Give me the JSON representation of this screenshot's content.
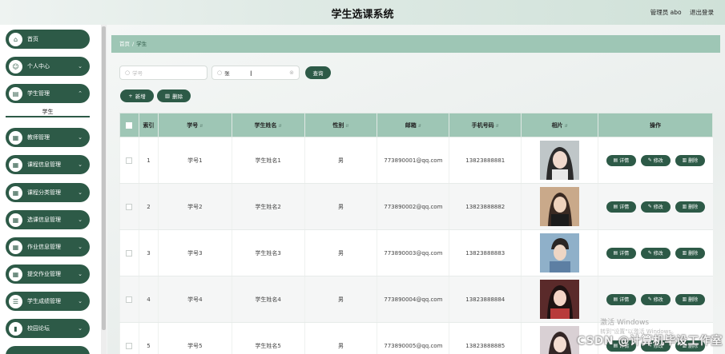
{
  "header": {
    "title": "学生选课系统",
    "user": "管理员 abo",
    "logout": "退出登录"
  },
  "sidebar": {
    "items": [
      {
        "label": "首页",
        "icon": "home-icon",
        "glyph": "⌂",
        "expandable": false
      },
      {
        "label": "个人中心",
        "icon": "user-icon",
        "glyph": "☺",
        "expandable": true
      },
      {
        "label": "学生管理",
        "icon": "document-icon",
        "glyph": "▤",
        "expandable": true
      },
      {
        "label": "教师管理",
        "icon": "grid-icon",
        "glyph": "▦",
        "expandable": true
      },
      {
        "label": "课程信息管理",
        "icon": "grid-icon",
        "glyph": "▦",
        "expandable": true
      },
      {
        "label": "课程分类管理",
        "icon": "grid-icon",
        "glyph": "▦",
        "expandable": true
      },
      {
        "label": "选课信息管理",
        "icon": "grid-icon",
        "glyph": "▦",
        "expandable": true
      },
      {
        "label": "作业信息管理",
        "icon": "grid-icon",
        "glyph": "▦",
        "expandable": true
      },
      {
        "label": "提交作业管理",
        "icon": "grid-icon",
        "glyph": "▦",
        "expandable": true
      },
      {
        "label": "学生成绩管理",
        "icon": "list-icon",
        "glyph": "☰",
        "expandable": true
      },
      {
        "label": "校园论坛",
        "icon": "chart-icon",
        "glyph": "▮",
        "expandable": true
      }
    ],
    "sub_item": "学生"
  },
  "breadcrumb": {
    "home": "首页",
    "sep": "/",
    "current": "学生"
  },
  "search": {
    "student_id_placeholder": "学号",
    "student_name_value": "张",
    "query_label": "查询"
  },
  "actions": {
    "add_label": "新增",
    "delete_label": "删除"
  },
  "table": {
    "columns": [
      "索引",
      "学号",
      "学生姓名",
      "性别",
      "邮箱",
      "手机号码",
      "相片",
      "操作"
    ],
    "rows": [
      {
        "index": "1",
        "id": "学号1",
        "name": "学生姓名1",
        "gender": "男",
        "email": "773890001@qq.com",
        "phone": "13823888881"
      },
      {
        "index": "2",
        "id": "学号2",
        "name": "学生姓名2",
        "gender": "男",
        "email": "773890002@qq.com",
        "phone": "13823888882"
      },
      {
        "index": "3",
        "id": "学号3",
        "name": "学生姓名3",
        "gender": "男",
        "email": "773890003@qq.com",
        "phone": "13823888883"
      },
      {
        "index": "4",
        "id": "学号4",
        "name": "学生姓名4",
        "gender": "男",
        "email": "773890004@qq.com",
        "phone": "13823888884"
      },
      {
        "index": "5",
        "id": "学号5",
        "name": "学生姓名5",
        "gender": "男",
        "email": "773890005@qq.com",
        "phone": "13823888885"
      }
    ],
    "row_actions": {
      "detail": "详情",
      "edit": "修改",
      "delete": "删除"
    }
  },
  "overlay": {
    "activate_title": "激活 Windows",
    "activate_sub": "转到\"设置\"以激活 Windows。",
    "watermark": "CSDN @计算机毕设工作室"
  },
  "colors": {
    "primary": "#2d5a47",
    "header_row": "#9ec6b5"
  }
}
